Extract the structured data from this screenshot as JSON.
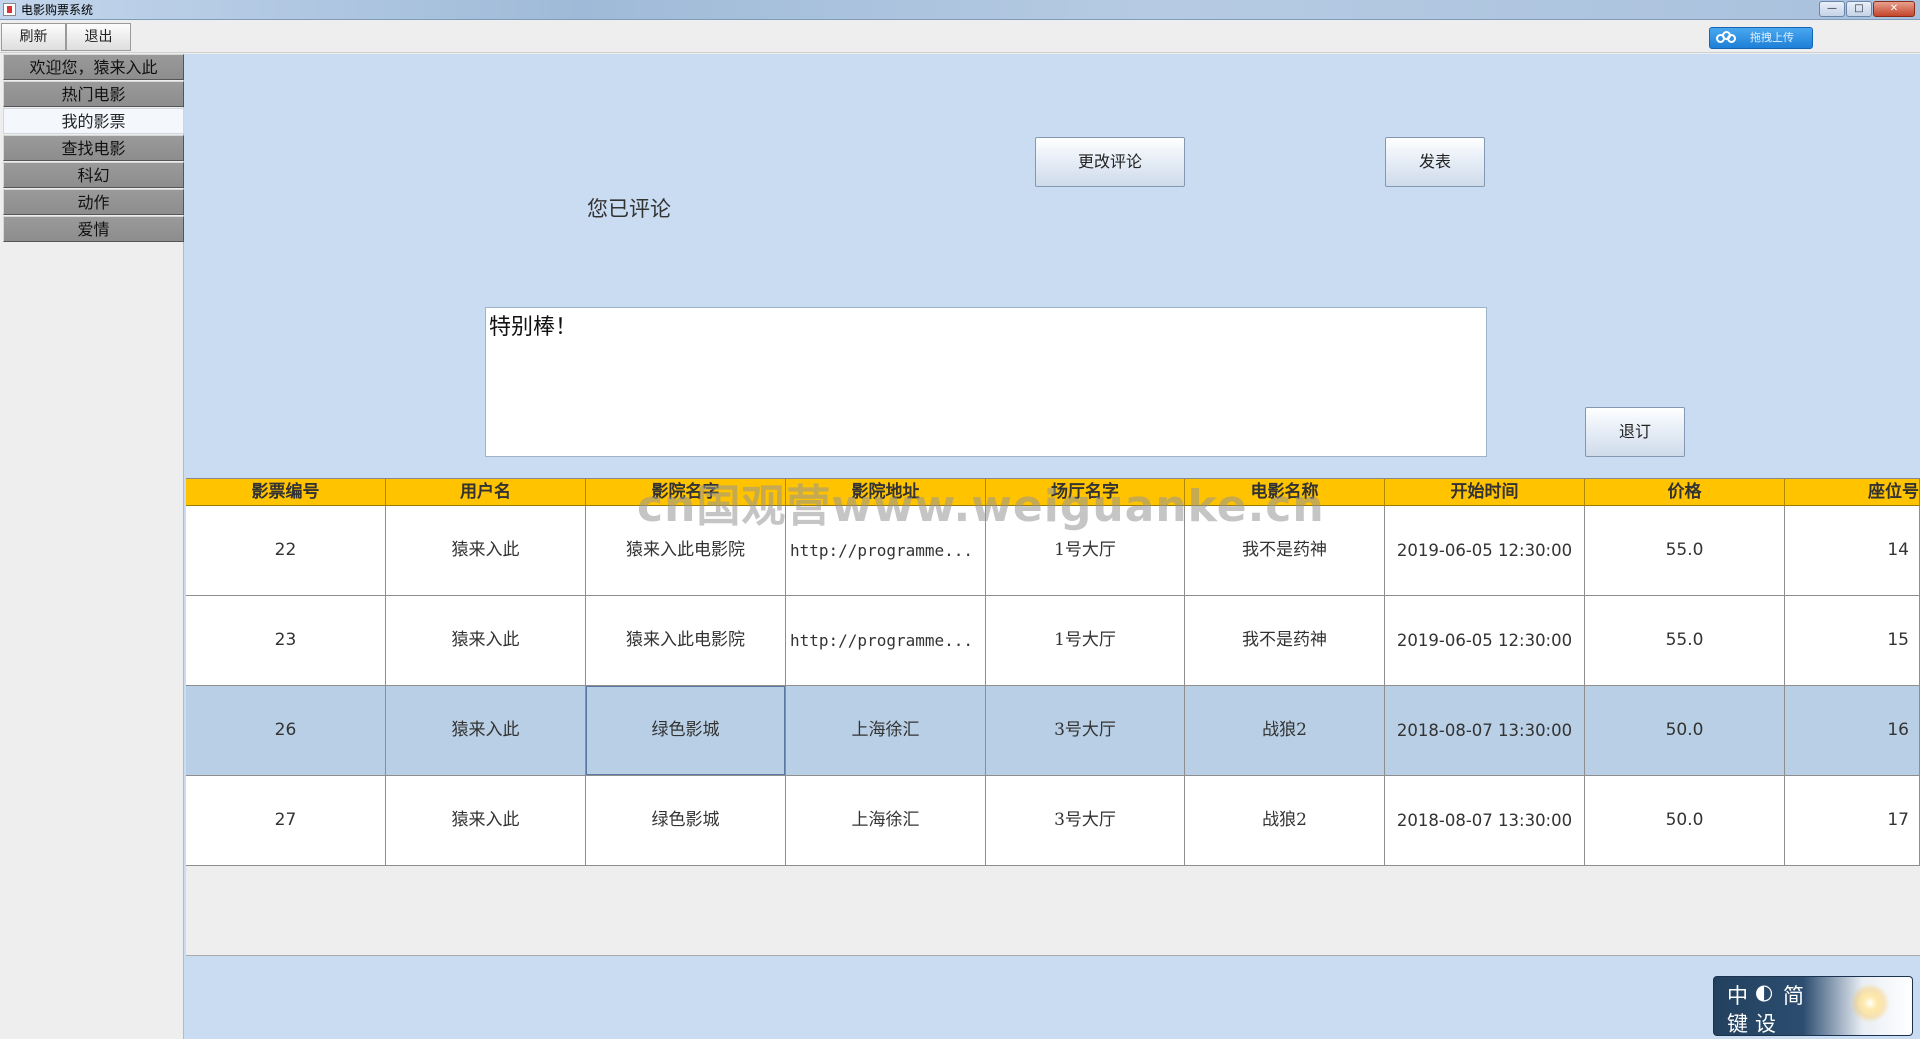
{
  "window": {
    "title": "电影购票系统",
    "controls": [
      "—",
      "□",
      "✕"
    ]
  },
  "menubar": {
    "refresh": "刷新",
    "exit": "退出",
    "upload": "拖拽上传"
  },
  "sidebar": {
    "items": [
      {
        "label": "欢迎您，猿来入此"
      },
      {
        "label": "热门电影"
      },
      {
        "label": "我的影票"
      },
      {
        "label": "查找电影"
      },
      {
        "label": "科幻"
      },
      {
        "label": "动作"
      },
      {
        "label": "爱情"
      }
    ],
    "active_index": 2
  },
  "review": {
    "change_button": "更改评论",
    "publish_button": "发表",
    "status_text": "您已评论",
    "comment_text": "特别棒！",
    "refund_button": "退订"
  },
  "table": {
    "columns": [
      "影票编号",
      "用户名",
      "影院名字",
      "影院地址",
      "场厅名字",
      "电影名称",
      "开始时间",
      "价格",
      "座位号"
    ],
    "rows": [
      [
        "22",
        "猿来入此",
        "猿来入此电影院",
        "http://programme...",
        "1号大厅",
        "我不是药神",
        "2019-06-05 12:30:00",
        "55.0",
        "14"
      ],
      [
        "23",
        "猿来入此",
        "猿来入此电影院",
        "http://programme...",
        "1号大厅",
        "我不是药神",
        "2019-06-05 12:30:00",
        "55.0",
        "15"
      ],
      [
        "26",
        "猿来入此",
        "绿色影城",
        "上海徐汇",
        "3号大厅",
        "战狼2",
        "2018-08-07 13:30:00",
        "50.0",
        "16"
      ],
      [
        "27",
        "猿来入此",
        "绿色影城",
        "上海徐汇",
        "3号大厅",
        "战狼2",
        "2018-08-07 13:30:00",
        "50.0",
        "17"
      ]
    ],
    "selected_row": 2
  },
  "watermark": "cn国观营www.weiguanke.cn",
  "ime": {
    "chars": [
      "中",
      "◐",
      "简",
      "键",
      "设"
    ]
  }
}
